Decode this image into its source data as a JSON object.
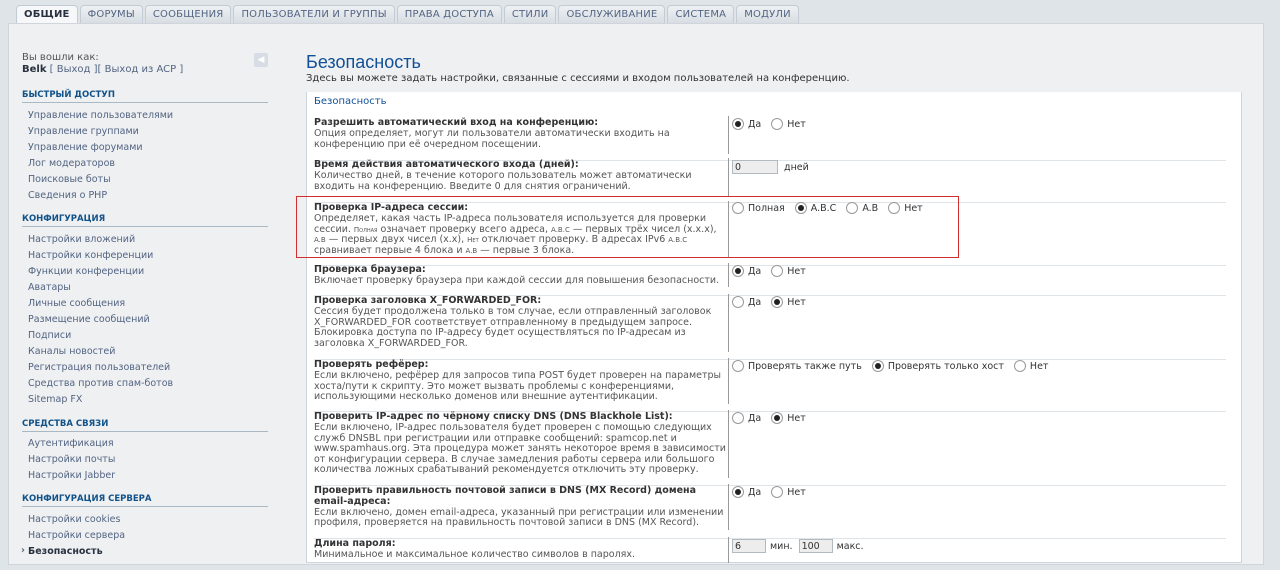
{
  "tabs": [
    "ОБЩИЕ",
    "ФОРУМЫ",
    "СООБЩЕНИЯ",
    "ПОЛЬЗОВАТЕЛИ И ГРУППЫ",
    "ПРАВА ДОСТУПА",
    "СТИЛИ",
    "ОБСЛУЖИВАНИЕ",
    "СИСТЕМА",
    "МОДУЛИ"
  ],
  "active_tab": 0,
  "login": {
    "label": "Вы вошли как:",
    "user": "Belk",
    "logout": "Выход",
    "exit_acp": "Выход из ACP"
  },
  "sidebar": [
    {
      "header": "БЫСТРЫЙ ДОСТУП",
      "items": [
        "Управление пользователями",
        "Управление группами",
        "Управление форумами",
        "Лог модераторов",
        "Поисковые боты",
        "Сведения о PHP"
      ]
    },
    {
      "header": "КОНФИГУРАЦИЯ",
      "items": [
        "Настройки вложений",
        "Настройки конференции",
        "Функции конференции",
        "Аватары",
        "Личные сообщения",
        "Размещение сообщений",
        "Подписи",
        "Каналы новостей",
        "Регистрация пользователей",
        "Средства против спам-ботов",
        "Sitemap FX"
      ]
    },
    {
      "header": "СРЕДСТВА СВЯЗИ",
      "items": [
        "Аутентификация",
        "Настройки почты",
        "Настройки Jabber"
      ]
    },
    {
      "header": "КОНФИГУРАЦИЯ СЕРВЕРА",
      "items": [
        "Настройки cookies",
        "Настройки сервера",
        "Безопасность"
      ]
    }
  ],
  "active_side_item": "Безопасность",
  "page": {
    "title": "Безопасность",
    "description": "Здесь вы можете задать настройки, связанные с сессиями и входом пользователей на конференцию.",
    "legend": "Безопасность"
  },
  "settings": [
    {
      "title": "Разрешить автоматический вход на конференцию:",
      "desc": "Опция определяет, могут ли пользователи автоматически входить на конференцию при её очередном посещении.",
      "type": "radio",
      "options": [
        "Да",
        "Нет"
      ],
      "selected": 0
    },
    {
      "title": "Время действия автоматического входа (дней):",
      "desc": "Количество дней, в течение которого пользователь может автоматически входить на конференцию. Введите 0 для снятия ограничений.",
      "type": "input",
      "value": "0",
      "unit": "дней"
    },
    {
      "title": "Проверка IP-адреса сессии:",
      "desc_parts": [
        "Определяет, какая часть IP-адреса пользователя используется для проверки сессии. ",
        "Полная",
        " означает проверку всего адреса, ",
        "A.B.C",
        " — первых трёх чисел (x.x.x), ",
        "A.B",
        " — первых двух чисел (x.x), ",
        "Нет",
        " отключает проверку. В адресах IPv6 ",
        "A.B.C",
        " сравнивает первые 4 блока и ",
        "A.B",
        " — первые 3 блока."
      ],
      "type": "radio",
      "options": [
        "Полная",
        "A.B.C",
        "A.B",
        "Нет"
      ],
      "selected": 1
    },
    {
      "title": "Проверка браузера:",
      "desc": "Включает проверку браузера при каждой сессии для повышения безопасности.",
      "type": "radio",
      "options": [
        "Да",
        "Нет"
      ],
      "selected": 0
    },
    {
      "title": "Проверка заголовка X_FORWARDED_FOR:",
      "desc": "Сессия будет продолжена только в том случае, если отправленный заголовок X_FORWARDED_FOR соответствует отправленному в предыдущем запросе. Блокировка доступа по IP-адресу будет осуществляться по IP-адресам из заголовка X_FORWARDED_FOR.",
      "type": "radio",
      "options": [
        "Да",
        "Нет"
      ],
      "selected": 1
    },
    {
      "title": "Проверять рефёрер:",
      "desc": "Если включено, рефёрер для запросов типа POST будет проверен на параметры хоста/пути к скрипту. Это может вызвать проблемы с конференциями, использующими несколько доменов или внешние аутентификации.",
      "type": "radio",
      "options": [
        "Проверять также путь",
        "Проверять только хост",
        "Нет"
      ],
      "selected": 1
    },
    {
      "title": "Проверить IP-адрес по чёрному списку DNS (DNS Blackhole List):",
      "desc": "Если включено, IP-адрес пользователя будет проверен с помощью следующих служб DNSBL при регистрации или отправке сообщений: spamcop.net и www.spamhaus.org. Эта процедура может занять некоторое время в зависимости от конфигурации сервера. В случае замедления работы сервера или большого количества ложных срабатываний рекомендуется отключить эту проверку.",
      "type": "radio",
      "options": [
        "Да",
        "Нет"
      ],
      "selected": 1
    },
    {
      "title": "Проверить правильность почтовой записи в DNS (MX Record) домена email-адреса:",
      "desc": "Если включено, домен email-адреса, указанный при регистрации или изменении профиля, проверяется на правильность почтовой записи в DNS (MX Record).",
      "type": "radio",
      "options": [
        "Да",
        "Нет"
      ],
      "selected": 0
    },
    {
      "title": "Длина пароля:",
      "desc": "Минимальное и максимальное количество символов в паролях.",
      "type": "range",
      "min": "6",
      "min_unit": "мин.",
      "max": "100",
      "max_unit": "макс."
    }
  ]
}
